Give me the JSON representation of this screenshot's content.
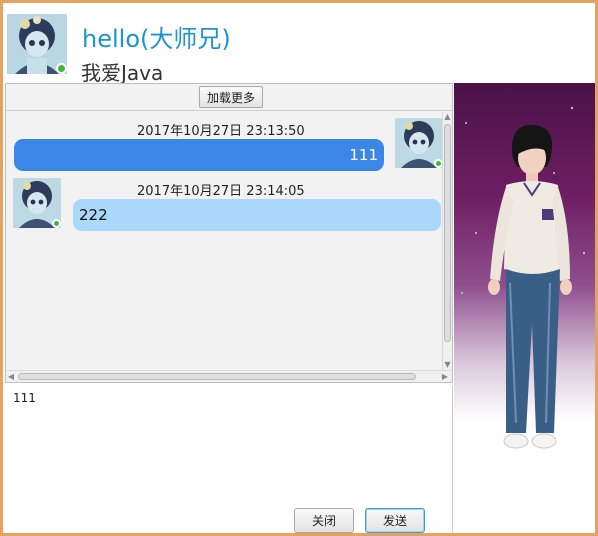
{
  "header": {
    "title": "hello(大师兄)",
    "subtitle": "我爱Java",
    "avatar_icon": "anime-girl-avatar",
    "status_icon": "online-status-icon"
  },
  "chat": {
    "load_more_label": "加载更多",
    "messages": [
      {
        "time": "2017年10月27日  23:13:50",
        "text": "111",
        "sender": "self"
      },
      {
        "time": "2017年10月27日  23:14:05",
        "text": "222",
        "sender": "other"
      }
    ]
  },
  "input": {
    "value": "111"
  },
  "buttons": {
    "close_label": "关闭",
    "send_label": "发送"
  },
  "colors": {
    "accent": "#1e93cf",
    "self_bubble": "#3b86e6",
    "other_bubble": "#a9d8fa",
    "window_border": "#e4a460",
    "online": "#3fb73a"
  }
}
